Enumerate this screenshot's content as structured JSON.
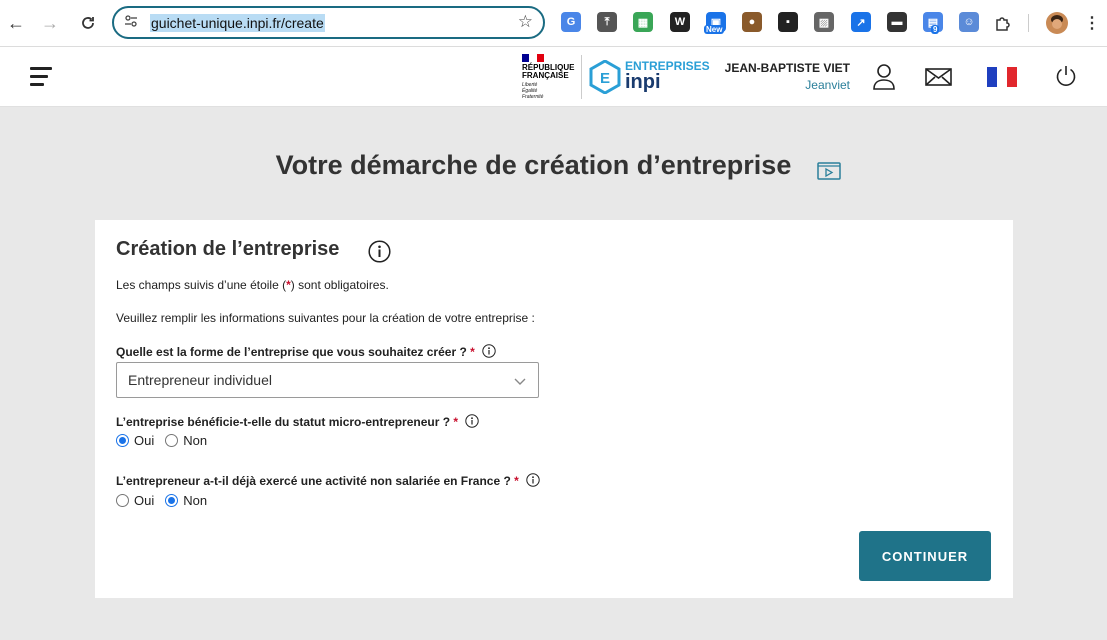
{
  "browser": {
    "url": "guichet-unique.inpi.fr/create",
    "extensions": [
      {
        "name": "google-translate-icon",
        "color": "#4a86e8"
      },
      {
        "name": "pin-icon",
        "color": "#555555"
      },
      {
        "name": "grid-icon",
        "color": "#3aa657"
      },
      {
        "name": "w-icon",
        "color": "#222222"
      },
      {
        "name": "new-extension-icon",
        "color": "#1a73e8"
      },
      {
        "name": "cookie-icon",
        "color": "#8a5a2b"
      },
      {
        "name": "tape-icon",
        "color": "#222222"
      },
      {
        "name": "image-icon",
        "color": "#666666"
      },
      {
        "name": "cursor-icon",
        "color": "#1a73e8"
      },
      {
        "name": "spy-icon",
        "color": "#333333"
      },
      {
        "name": "translate-badge-icon",
        "color": "#4a86e8"
      },
      {
        "name": "person-icon",
        "color": "#5b8bd8"
      }
    ],
    "new_badge": "New",
    "count_badge": "9"
  },
  "header": {
    "rf_line1": "RÉPUBLIQUE",
    "rf_line2": "FRANÇAISE",
    "rf_motto1": "Liberté",
    "rf_motto2": "Égalité",
    "rf_motto3": "Fraternité",
    "brand_top": "ENTREPRISES",
    "brand_bottom": "inpi",
    "user_name": "JEAN-BAPTISTE VIET",
    "user_login": "Jeanviet"
  },
  "page": {
    "title": "Votre démarche de création d’entreprise"
  },
  "form": {
    "section_title": "Création de l’entreprise",
    "required_note_before": "Les champs suivis d’une étoile (",
    "required_star": "*",
    "required_note_after": ") sont obligatoires.",
    "intro": "Veuillez remplir les informations suivantes pour la création de votre entreprise :",
    "q1_label": "Quelle est la forme de l’entreprise que vous souhaitez créer ?",
    "q1_value": "Entrepreneur individuel",
    "q2_label": "L’entreprise bénéficie-t-elle du statut micro-entrepreneur ?",
    "q2_yes": "Oui",
    "q2_no": "Non",
    "q2_selected": "Oui",
    "q3_label": "L’entrepreneur a-t-il déjà exercé une activité non salariée en France ?",
    "q3_yes": "Oui",
    "q3_no": "Non",
    "q3_selected": "Non",
    "continue_label": "CONTINUER"
  }
}
